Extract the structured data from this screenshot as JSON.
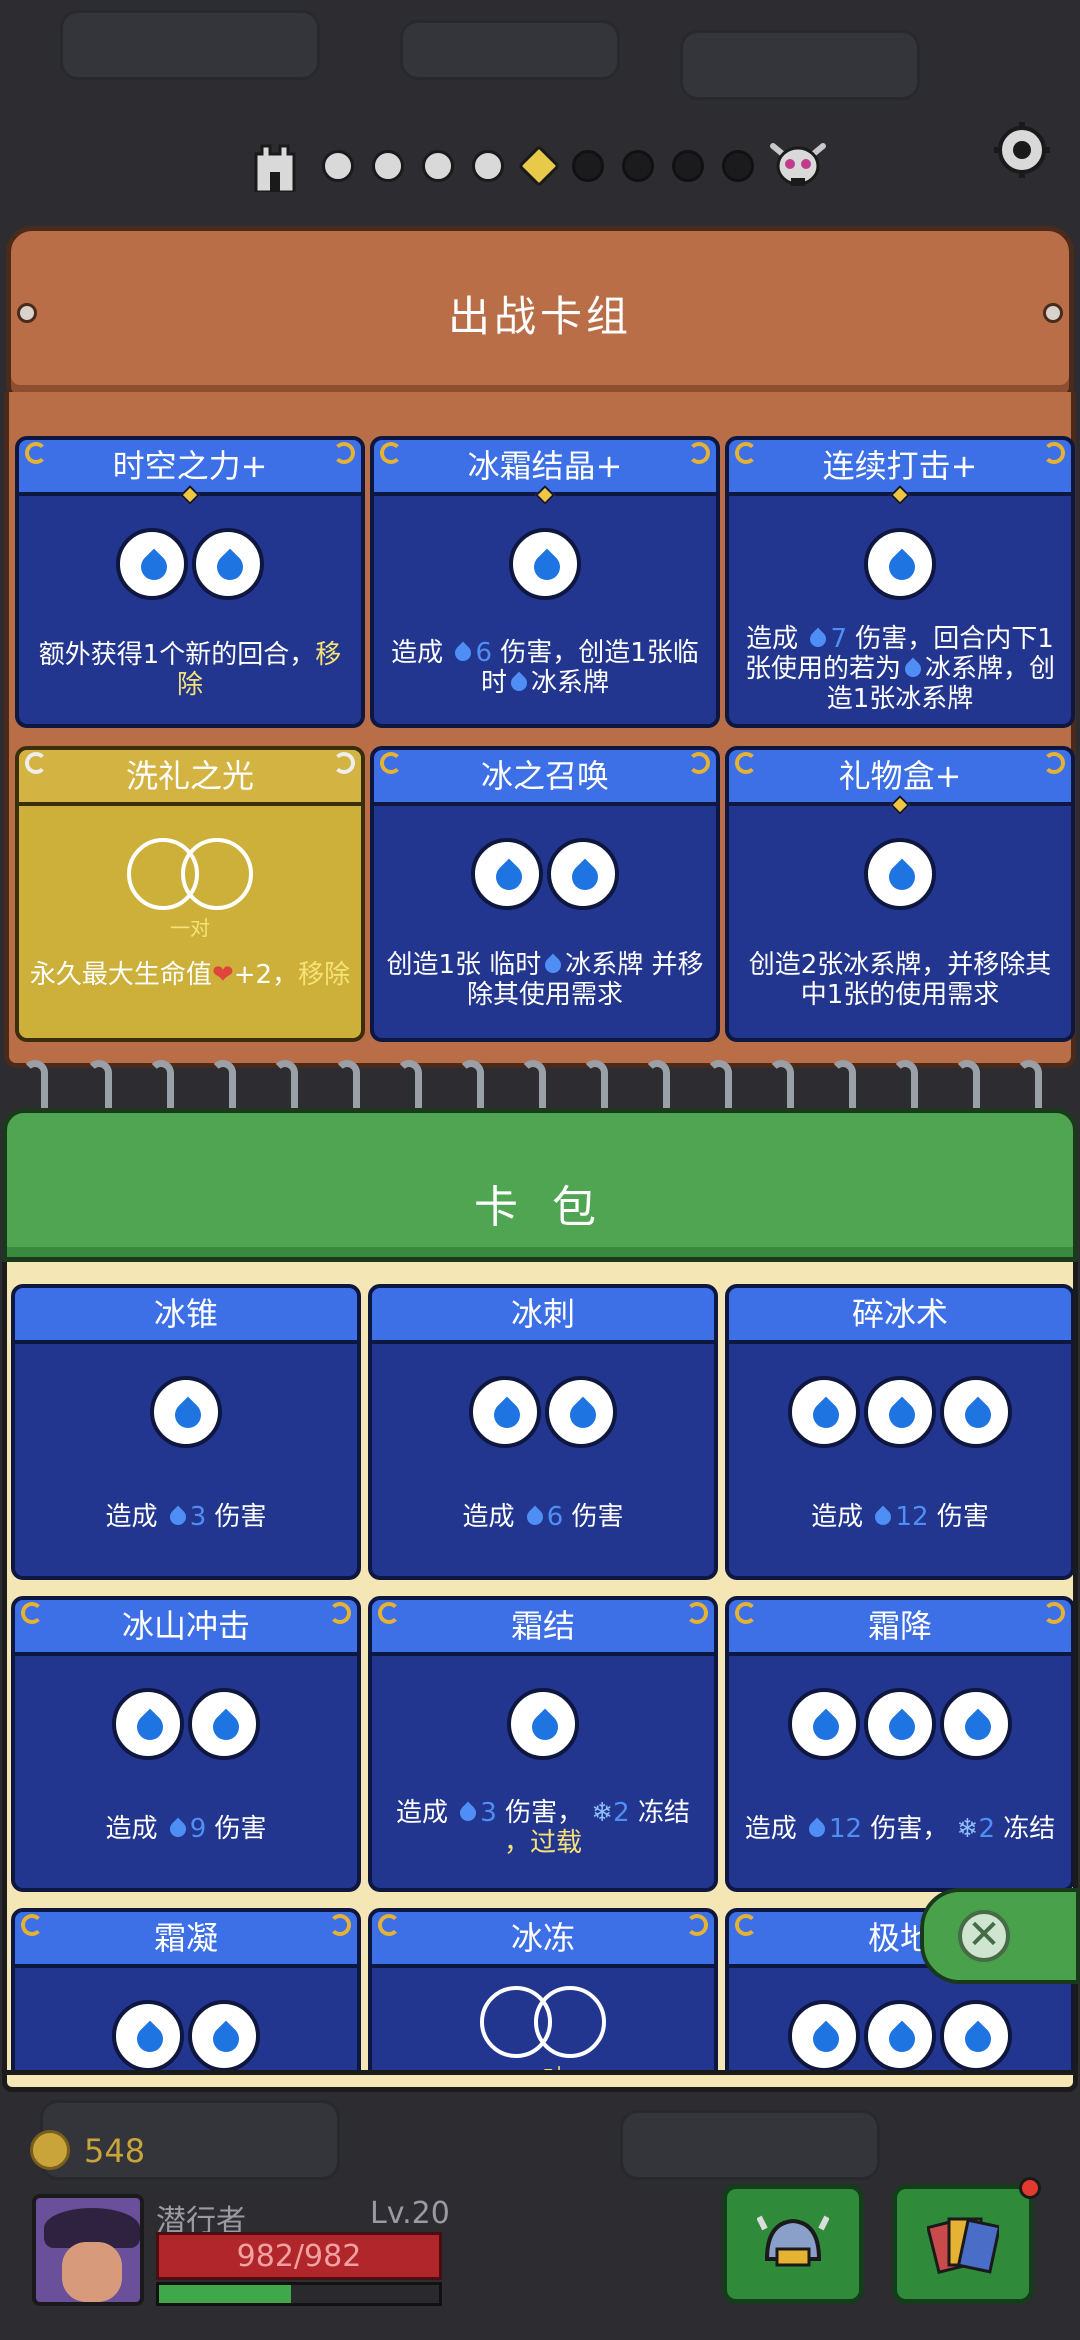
{
  "deck": {
    "title": "出战卡组",
    "cards": [
      {
        "name": "时空之力+",
        "cost": 2,
        "desc_plain": "额外获得1个新的回合，",
        "desc_hl": "移除",
        "variant": "blue"
      },
      {
        "name": "冰霜结晶+",
        "cost": 1,
        "desc_pre": "造成",
        "dmg": "6",
        "desc_post": "伤害，创造1张临时",
        "desc_tail": "冰系牌",
        "variant": "blue"
      },
      {
        "name": "连续打击+",
        "cost": 1,
        "desc_pre": "造成",
        "dmg": "7",
        "desc_post": "伤害，回合内下1张使用的若为",
        "desc_tail": "冰系牌，创造1张冰系牌",
        "variant": "blue"
      },
      {
        "name": "洗礼之光",
        "pair_label": "一对",
        "desc_plain": "永久最大生命值",
        "desc_mid": "+2，",
        "desc_hl": "移除",
        "variant": "gold"
      },
      {
        "name": "冰之召唤",
        "cost": 2,
        "desc_pre": "创造1张 临时",
        "desc_tail": "冰系牌 并移除其使用需求",
        "variant": "blue"
      },
      {
        "name": "礼物盒+",
        "cost": 1,
        "desc_plain": "创造2张冰系牌，并移除其中1张的使用需求",
        "variant": "blue"
      }
    ]
  },
  "pack": {
    "title": "卡 包",
    "cards": [
      {
        "name": "冰锥",
        "cost": 1,
        "desc_pre": "造成",
        "dmg": "3",
        "desc_post": "伤害"
      },
      {
        "name": "冰刺",
        "cost": 2,
        "desc_pre": "造成",
        "dmg": "6",
        "desc_post": "伤害"
      },
      {
        "name": "碎冰术",
        "cost": 3,
        "desc_pre": "造成",
        "dmg": "12",
        "desc_post": "伤害"
      },
      {
        "name": "冰山冲击",
        "cost": 2,
        "desc_pre": "造成",
        "dmg": "9",
        "desc_post": "伤害"
      },
      {
        "name": "霜结",
        "cost": 1,
        "desc_pre": "造成",
        "dmg": "3",
        "desc_post": "伤害，",
        "freeze": "2",
        "freeze_label": "冻结",
        "overload": "，过载"
      },
      {
        "name": "霜降",
        "cost": 3,
        "desc_pre": "造成",
        "dmg": "12",
        "desc_post": "伤害，",
        "freeze": "2",
        "freeze_label": "冻结"
      },
      {
        "name": "霜凝",
        "cost": 2
      },
      {
        "name": "冰冻",
        "pair_label": "一对"
      },
      {
        "name": "极地",
        "cost": 3
      }
    ]
  },
  "close_label": "✕",
  "coins": "548",
  "hero": {
    "name": "潜行者",
    "level": "Lv.20",
    "hp": "982/982",
    "xp_fraction": 0.47
  },
  "colors": {
    "card_blue": "#23368f",
    "card_header": "#3d6fe6",
    "gold": "#cdb03a",
    "deck_wood": "#b96e48",
    "pack_green": "#4fa552"
  },
  "icons": {
    "settings": "gear-icon",
    "castle": "castle-icon",
    "boss": "skull-icon",
    "deck_button": "helmet-icon",
    "cards_button": "cards-icon"
  }
}
